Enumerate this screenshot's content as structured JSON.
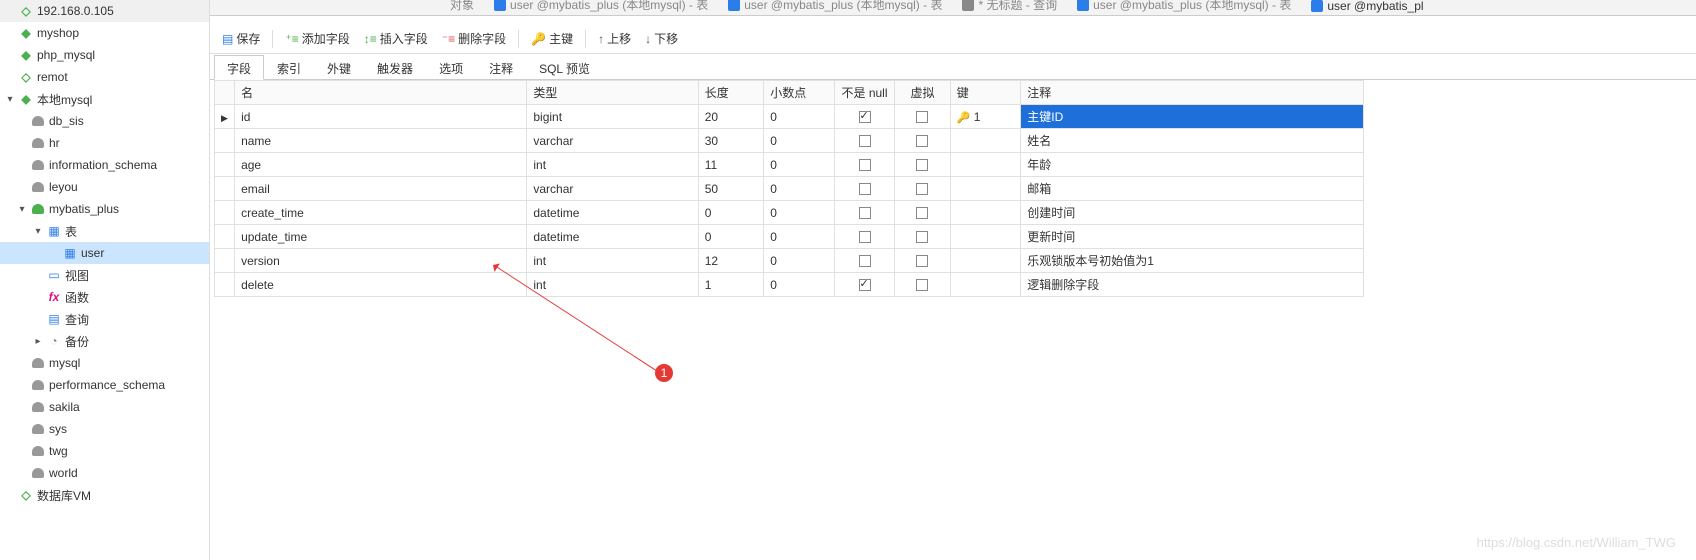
{
  "sidebar": {
    "items": [
      {
        "label": "192.168.0.105",
        "type": "conn",
        "indent": 0
      },
      {
        "label": "myshop",
        "type": "conn",
        "indent": 0,
        "iconColor": "green"
      },
      {
        "label": "php_mysql",
        "type": "conn",
        "indent": 0,
        "iconColor": "green"
      },
      {
        "label": "remot",
        "type": "conn",
        "indent": 0
      },
      {
        "label": "本地mysql",
        "type": "conn",
        "indent": 0,
        "expand": "open",
        "iconColor": "green"
      },
      {
        "label": "db_sis",
        "type": "db",
        "indent": 1
      },
      {
        "label": "hr",
        "type": "db",
        "indent": 1
      },
      {
        "label": "information_schema",
        "type": "db",
        "indent": 1
      },
      {
        "label": "leyou",
        "type": "db",
        "indent": 1
      },
      {
        "label": "mybatis_plus",
        "type": "db",
        "indent": 1,
        "expand": "open",
        "active": true
      },
      {
        "label": "表",
        "type": "table-folder",
        "indent": 2,
        "expand": "open"
      },
      {
        "label": "user",
        "type": "table",
        "indent": 3,
        "selected": true
      },
      {
        "label": "视图",
        "type": "view",
        "indent": 2
      },
      {
        "label": "函数",
        "type": "fn",
        "indent": 2
      },
      {
        "label": "查询",
        "type": "query",
        "indent": 2
      },
      {
        "label": "备份",
        "type": "backup",
        "indent": 2,
        "expand": "closed"
      },
      {
        "label": "mysql",
        "type": "db",
        "indent": 1
      },
      {
        "label": "performance_schema",
        "type": "db",
        "indent": 1
      },
      {
        "label": "sakila",
        "type": "db",
        "indent": 1
      },
      {
        "label": "sys",
        "type": "db",
        "indent": 1
      },
      {
        "label": "twg",
        "type": "db",
        "indent": 1
      },
      {
        "label": "world",
        "type": "db",
        "indent": 1
      },
      {
        "label": "数据库VM",
        "type": "conn",
        "indent": 0
      }
    ]
  },
  "editorTabs": {
    "obj": "对象",
    "t1": "user @mybatis_plus (本地mysql) - 表",
    "t2": "user @mybatis_plus (本地mysql) - 表",
    "t3": "* 无标题 - 查询",
    "t4": "user @mybatis_plus (本地mysql) - 表",
    "t5": "user @mybatis_pl"
  },
  "toolbar": {
    "save": "保存",
    "addField": "添加字段",
    "insertField": "插入字段",
    "deleteField": "删除字段",
    "primaryKey": "主键",
    "moveUp": "上移",
    "moveDown": "下移"
  },
  "subtabs": [
    "字段",
    "索引",
    "外键",
    "触发器",
    "选项",
    "注释",
    "SQL 预览"
  ],
  "columns": {
    "headers": {
      "name": "名",
      "type": "类型",
      "length": "长度",
      "decimals": "小数点",
      "notnull": "不是 null",
      "virtual": "虚拟",
      "key": "键",
      "comment": "注释"
    },
    "rows": [
      {
        "current": true,
        "name": "id",
        "type": "bigint",
        "length": "20",
        "decimals": "0",
        "notnull": true,
        "virtual": false,
        "key": "1",
        "comment": "主键ID",
        "commentSelected": true
      },
      {
        "name": "name",
        "type": "varchar",
        "length": "30",
        "decimals": "0",
        "notnull": false,
        "virtual": false,
        "key": "",
        "comment": "姓名"
      },
      {
        "name": "age",
        "type": "int",
        "length": "11",
        "decimals": "0",
        "notnull": false,
        "virtual": false,
        "key": "",
        "comment": "年龄"
      },
      {
        "name": "email",
        "type": "varchar",
        "length": "50",
        "decimals": "0",
        "notnull": false,
        "virtual": false,
        "key": "",
        "comment": "邮箱"
      },
      {
        "name": "create_time",
        "type": "datetime",
        "length": "0",
        "decimals": "0",
        "notnull": false,
        "virtual": false,
        "key": "",
        "comment": "创建时间"
      },
      {
        "name": "update_time",
        "type": "datetime",
        "length": "0",
        "decimals": "0",
        "notnull": false,
        "virtual": false,
        "key": "",
        "comment": "更新时间"
      },
      {
        "name": "version",
        "type": "int",
        "length": "12",
        "decimals": "0",
        "notnull": false,
        "virtual": false,
        "key": "",
        "comment": "乐观锁版本号初始值为1"
      },
      {
        "name": "delete",
        "type": "int",
        "length": "1",
        "decimals": "0",
        "notnull": true,
        "virtual": false,
        "key": "",
        "comment": "逻辑删除字段"
      }
    ]
  },
  "annotation": {
    "number": "1"
  },
  "watermark": "https://blog.csdn.net/William_TWG"
}
